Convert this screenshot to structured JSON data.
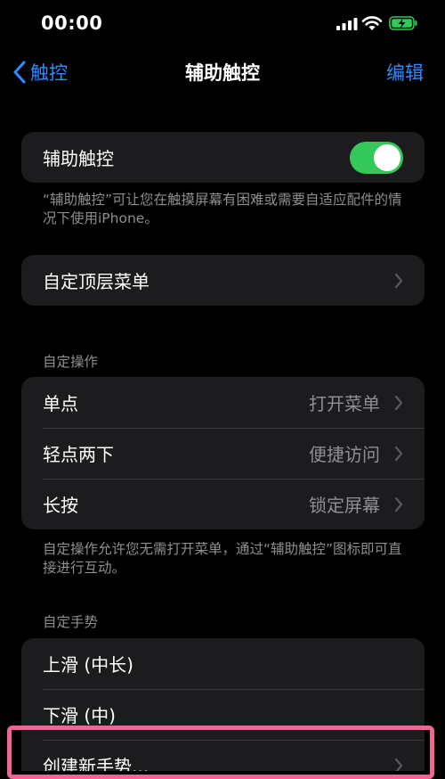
{
  "status_bar": {
    "time": "00:00"
  },
  "nav": {
    "back_label": "触控",
    "title": "辅助触控",
    "edit_label": "编辑"
  },
  "assistive_touch": {
    "label": "辅助触控",
    "enabled": true,
    "footer": "“辅助触控”可让您在触摸屏幕有困难或需要自适应配件的情况下使用iPhone。"
  },
  "top_menu": {
    "label": "自定顶层菜单"
  },
  "custom_actions": {
    "header": "自定操作",
    "items": [
      {
        "label": "单点",
        "value": "打开菜单"
      },
      {
        "label": "轻点两下",
        "value": "便捷访问"
      },
      {
        "label": "长按",
        "value": "锁定屏幕"
      }
    ],
    "footer": "自定操作允许您无需打开菜单，通过“辅助触控”图标即可直接进行互动。"
  },
  "custom_gestures": {
    "header": "自定手势",
    "items": [
      {
        "label": "上滑 (中长)"
      },
      {
        "label": "下滑 (中)"
      },
      {
        "label": "创建新手势..."
      }
    ]
  },
  "colors": {
    "accent": "#2f8bff",
    "toggle_on": "#34c759",
    "highlight": "#f06595",
    "cell": "#1c1c1e"
  }
}
